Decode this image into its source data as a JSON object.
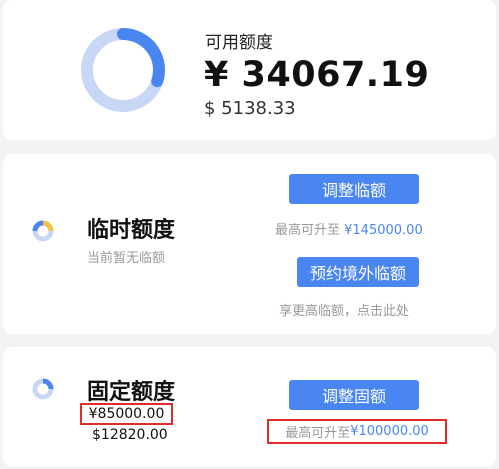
{
  "available": {
    "label": "可用额度",
    "amount_cny": "¥ 34067.19",
    "amount_usd": "$ 5138.33",
    "ring_fraction": 0.3
  },
  "temporary": {
    "label": "临时额度",
    "status": "当前暂无临额",
    "adjust_button": "调整临额",
    "adjust_hint_prefix": "最高可升至 ",
    "adjust_hint_amount": "¥145000.00",
    "reserve_button": "预约境外临额",
    "reserve_hint": "享更高临额，点击此处"
  },
  "fixed": {
    "label": "固定额度",
    "amount_cny": "¥85000.00",
    "amount_usd": "$12820.00",
    "adjust_button": "调整固额",
    "adjust_hint_prefix": "最高可升至 ",
    "adjust_hint_amount": "¥100000.00"
  },
  "colors": {
    "accent": "#4a86f2",
    "ring_track": "#c9d7f6",
    "highlight_box": "#e12c2c",
    "temp_icon_accent": "#f2c14a"
  }
}
